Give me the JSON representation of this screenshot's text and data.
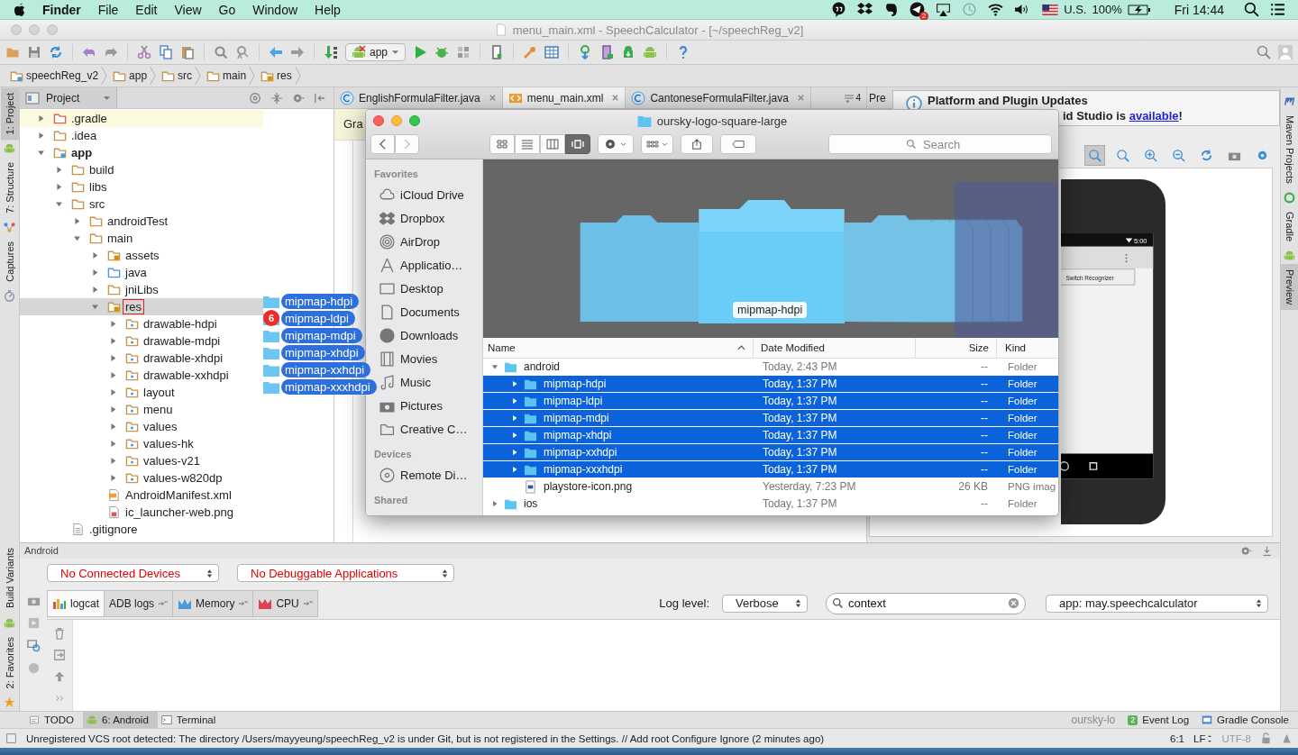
{
  "menu_bar": {
    "app_name": "Finder",
    "menus": [
      "File",
      "Edit",
      "View",
      "Go",
      "Window",
      "Help"
    ],
    "notification_badge": "2",
    "input_source": "U.S.",
    "battery": "100%",
    "clock": "Fri 14:44"
  },
  "ide": {
    "window_title": "menu_main.xml - SpeechCalculator - [~/speechReg_v2]",
    "run_config": "app",
    "breadcrumbs": [
      "speechReg_v2",
      "app",
      "src",
      "main",
      "res"
    ],
    "left_tool_tabs": [
      {
        "label": "1: Project",
        "selected": true
      },
      {
        "label": "7: Structure",
        "selected": false
      },
      {
        "label": "Captures",
        "selected": false
      }
    ],
    "left_tool_tabs_bottom": [
      {
        "label": "Build Variants",
        "selected": false
      },
      {
        "label": "2: Favorites",
        "selected": false
      }
    ],
    "right_tool_tabs": [
      {
        "label": "Maven Projects",
        "selected": false
      },
      {
        "label": "Gradle",
        "selected": false
      },
      {
        "label": "Preview",
        "selected": true
      }
    ],
    "project_panel": {
      "title": "Project",
      "tree": [
        {
          "label": ".gradle",
          "kind": "excluded",
          "expanded": false,
          "selected": false,
          "drop_target": false
        },
        {
          "label": ".idea",
          "kind": "folder",
          "expanded": false,
          "selected": false,
          "drop_target": false
        },
        {
          "label": "app",
          "kind": "module",
          "expanded": true,
          "selected": false,
          "drop_target": false,
          "children": [
            {
              "label": "build",
              "kind": "folder",
              "expanded": false,
              "selected": false,
              "drop_target": false
            },
            {
              "label": "libs",
              "kind": "folder",
              "expanded": false,
              "selected": false,
              "drop_target": false
            },
            {
              "label": "src",
              "kind": "folder",
              "expanded": true,
              "selected": false,
              "drop_target": false,
              "children": [
                {
                  "label": "androidTest",
                  "kind": "folder",
                  "expanded": false,
                  "selected": false,
                  "drop_target": false
                },
                {
                  "label": "main",
                  "kind": "folder",
                  "expanded": true,
                  "selected": false,
                  "drop_target": false,
                  "children": [
                    {
                      "label": "assets",
                      "kind": "resource",
                      "expanded": false,
                      "selected": false,
                      "drop_target": false
                    },
                    {
                      "label": "java",
                      "kind": "source",
                      "expanded": false,
                      "selected": false,
                      "drop_target": false
                    },
                    {
                      "label": "jniLibs",
                      "kind": "folder",
                      "expanded": false,
                      "selected": false,
                      "drop_target": false
                    },
                    {
                      "label": "res",
                      "kind": "resource",
                      "expanded": true,
                      "selected": true,
                      "drop_target": true,
                      "children": [
                        {
                          "label": "drawable-hdpi",
                          "kind": "res",
                          "expanded": false,
                          "selected": false,
                          "drop_target": false
                        },
                        {
                          "label": "drawable-mdpi",
                          "kind": "res",
                          "expanded": false,
                          "selected": false,
                          "drop_target": false
                        },
                        {
                          "label": "drawable-xhdpi",
                          "kind": "res",
                          "expanded": false,
                          "selected": false,
                          "drop_target": false
                        },
                        {
                          "label": "drawable-xxhdpi",
                          "kind": "res",
                          "expanded": false,
                          "selected": false,
                          "drop_target": false
                        },
                        {
                          "label": "layout",
                          "kind": "res",
                          "expanded": false,
                          "selected": false,
                          "drop_target": false
                        },
                        {
                          "label": "menu",
                          "kind": "res",
                          "expanded": false,
                          "selected": false,
                          "drop_target": false
                        },
                        {
                          "label": "values",
                          "kind": "res",
                          "expanded": false,
                          "selected": false,
                          "drop_target": false
                        },
                        {
                          "label": "values-hk",
                          "kind": "res",
                          "expanded": false,
                          "selected": false,
                          "drop_target": false
                        },
                        {
                          "label": "values-v21",
                          "kind": "res",
                          "expanded": false,
                          "selected": false,
                          "drop_target": false
                        },
                        {
                          "label": "values-w820dp",
                          "kind": "res",
                          "expanded": false,
                          "selected": false,
                          "drop_target": false
                        }
                      ]
                    },
                    {
                      "label": "AndroidManifest.xml",
                      "kind": "manifest",
                      "selected": false,
                      "drop_target": false
                    },
                    {
                      "label": "ic_launcher-web.png",
                      "kind": "image",
                      "selected": false,
                      "drop_target": false
                    }
                  ]
                }
              ]
            },
            {
              "label": ".gitignore",
              "kind": "text",
              "selected": false,
              "drop_target": false
            }
          ]
        }
      ]
    },
    "editor_tabs": [
      {
        "label": "EnglishFormulaFilter.java",
        "kind": "java",
        "selected": false
      },
      {
        "label": "menu_main.xml",
        "kind": "xml",
        "selected": true
      },
      {
        "label": "CantoneseFormulaFilter.java",
        "kind": "java",
        "selected": false
      }
    ],
    "hidden_tabs_count": "4",
    "editor_banner": "Gra",
    "preview_tab": "Pre",
    "notification": {
      "title": "Platform and Plugin Updates",
      "text": "id Studio is ",
      "link": "available",
      "text_end": "!"
    },
    "preview": {
      "status_time": "5:00",
      "button": "Switch Recognizer"
    },
    "android_panel": {
      "title": "Android",
      "device_select": "No Connected Devices",
      "app_select": "No Debuggable Applications",
      "tabs": [
        {
          "label": "logcat",
          "kind": "logcat",
          "selected": true
        },
        {
          "label": "ADB logs",
          "kind": "adb",
          "selected": false
        },
        {
          "label": "Memory",
          "kind": "memory",
          "selected": false
        },
        {
          "label": "CPU",
          "kind": "cpu",
          "selected": false
        }
      ],
      "log_level_label": "Log level:",
      "log_level": "Verbose",
      "filter": "context",
      "process": "app: may.speechcalculator"
    },
    "tool_windows_left": [
      {
        "label": "TODO",
        "kind": "todo",
        "selected": false
      },
      {
        "label": "6: Android",
        "kind": "android",
        "selected": true
      },
      {
        "label": "Terminal",
        "kind": "terminal",
        "selected": false
      }
    ],
    "drag_ghost_text": "oursky-lo",
    "tool_windows_right": [
      {
        "label": "Event Log",
        "kind": "event",
        "badge": "2"
      },
      {
        "label": "Gradle Console",
        "kind": "console"
      }
    ],
    "status_bar": {
      "message": "Unregistered VCS root detected: The directory /Users/mayyeung/speechReg_v2 is under Git, but is not registered in the Settings. // Add root  Configure  Ignore (2 minutes ago)",
      "position": "6:1",
      "line_separator": "LF",
      "encoding": "UTF-8",
      "encoding_disabled": true
    }
  },
  "finder": {
    "title": "oursky-logo-square-large",
    "view_modes": [
      {
        "selected": false
      },
      {
        "selected": false
      },
      {
        "selected": false
      },
      {
        "selected": true
      }
    ],
    "search_placeholder": "Search",
    "sidebar": [
      {
        "heading": "Favorites",
        "items": [
          {
            "label": "iCloud Drive",
            "kind": "cloud"
          },
          {
            "label": "Dropbox",
            "kind": "dropbox"
          },
          {
            "label": "AirDrop",
            "kind": "airdrop"
          },
          {
            "label": "Applicatio…",
            "kind": "apps"
          },
          {
            "label": "Desktop",
            "kind": "desktop"
          },
          {
            "label": "Documents",
            "kind": "documents"
          },
          {
            "label": "Downloads",
            "kind": "downloads"
          },
          {
            "label": "Movies",
            "kind": "movies"
          },
          {
            "label": "Music",
            "kind": "music"
          },
          {
            "label": "Pictures",
            "kind": "pictures"
          },
          {
            "label": "Creative C…",
            "kind": "folder"
          }
        ]
      },
      {
        "heading": "Devices",
        "items": [
          {
            "label": "Remote Di…",
            "kind": "disc"
          }
        ]
      },
      {
        "heading": "Shared"
      }
    ],
    "cover_caption": "mipmap-hdpi",
    "columns": [
      "Name",
      "Date Modified",
      "Size",
      "Kind"
    ],
    "rows": [
      {
        "name": "android",
        "kind": "folder",
        "date": "Today, 2:43 PM",
        "size": "--",
        "type": "Folder",
        "expanded": true,
        "selected": false,
        "children": [
          {
            "name": "mipmap-hdpi",
            "kind": "folder",
            "date": "Today, 1:37 PM",
            "size": "--",
            "type": "Folder",
            "expanded": false,
            "selected": true
          },
          {
            "name": "mipmap-ldpi",
            "kind": "folder",
            "date": "Today, 1:37 PM",
            "size": "--",
            "type": "Folder",
            "expanded": false,
            "selected": true
          },
          {
            "name": "mipmap-mdpi",
            "kind": "folder",
            "date": "Today, 1:37 PM",
            "size": "--",
            "type": "Folder",
            "expanded": false,
            "selected": true
          },
          {
            "name": "mipmap-xhdpi",
            "kind": "folder",
            "date": "Today, 1:37 PM",
            "size": "--",
            "type": "Folder",
            "expanded": false,
            "selected": true
          },
          {
            "name": "mipmap-xxhdpi",
            "kind": "folder",
            "date": "Today, 1:37 PM",
            "size": "--",
            "type": "Folder",
            "expanded": false,
            "selected": true
          },
          {
            "name": "mipmap-xxxhdpi",
            "kind": "folder",
            "date": "Today, 1:37 PM",
            "size": "--",
            "type": "Folder",
            "expanded": false,
            "selected": true
          },
          {
            "name": "playstore-icon.png",
            "kind": "image",
            "date": "Yesterday, 7:23 PM",
            "size": "26 KB",
            "type": "PNG imag",
            "selected": false
          }
        ]
      },
      {
        "name": "ios",
        "kind": "folder",
        "date": "Today, 1:37 PM",
        "size": "--",
        "type": "Folder",
        "expanded": false,
        "selected": false
      }
    ]
  },
  "drag": {
    "count": "6",
    "items": [
      "mipmap-hdpi",
      "mipmap-ldpi",
      "mipmap-mdpi",
      "mipmap-xhdpi",
      "mipmap-xxhdpi",
      "mipmap-xxxhdpi"
    ]
  }
}
